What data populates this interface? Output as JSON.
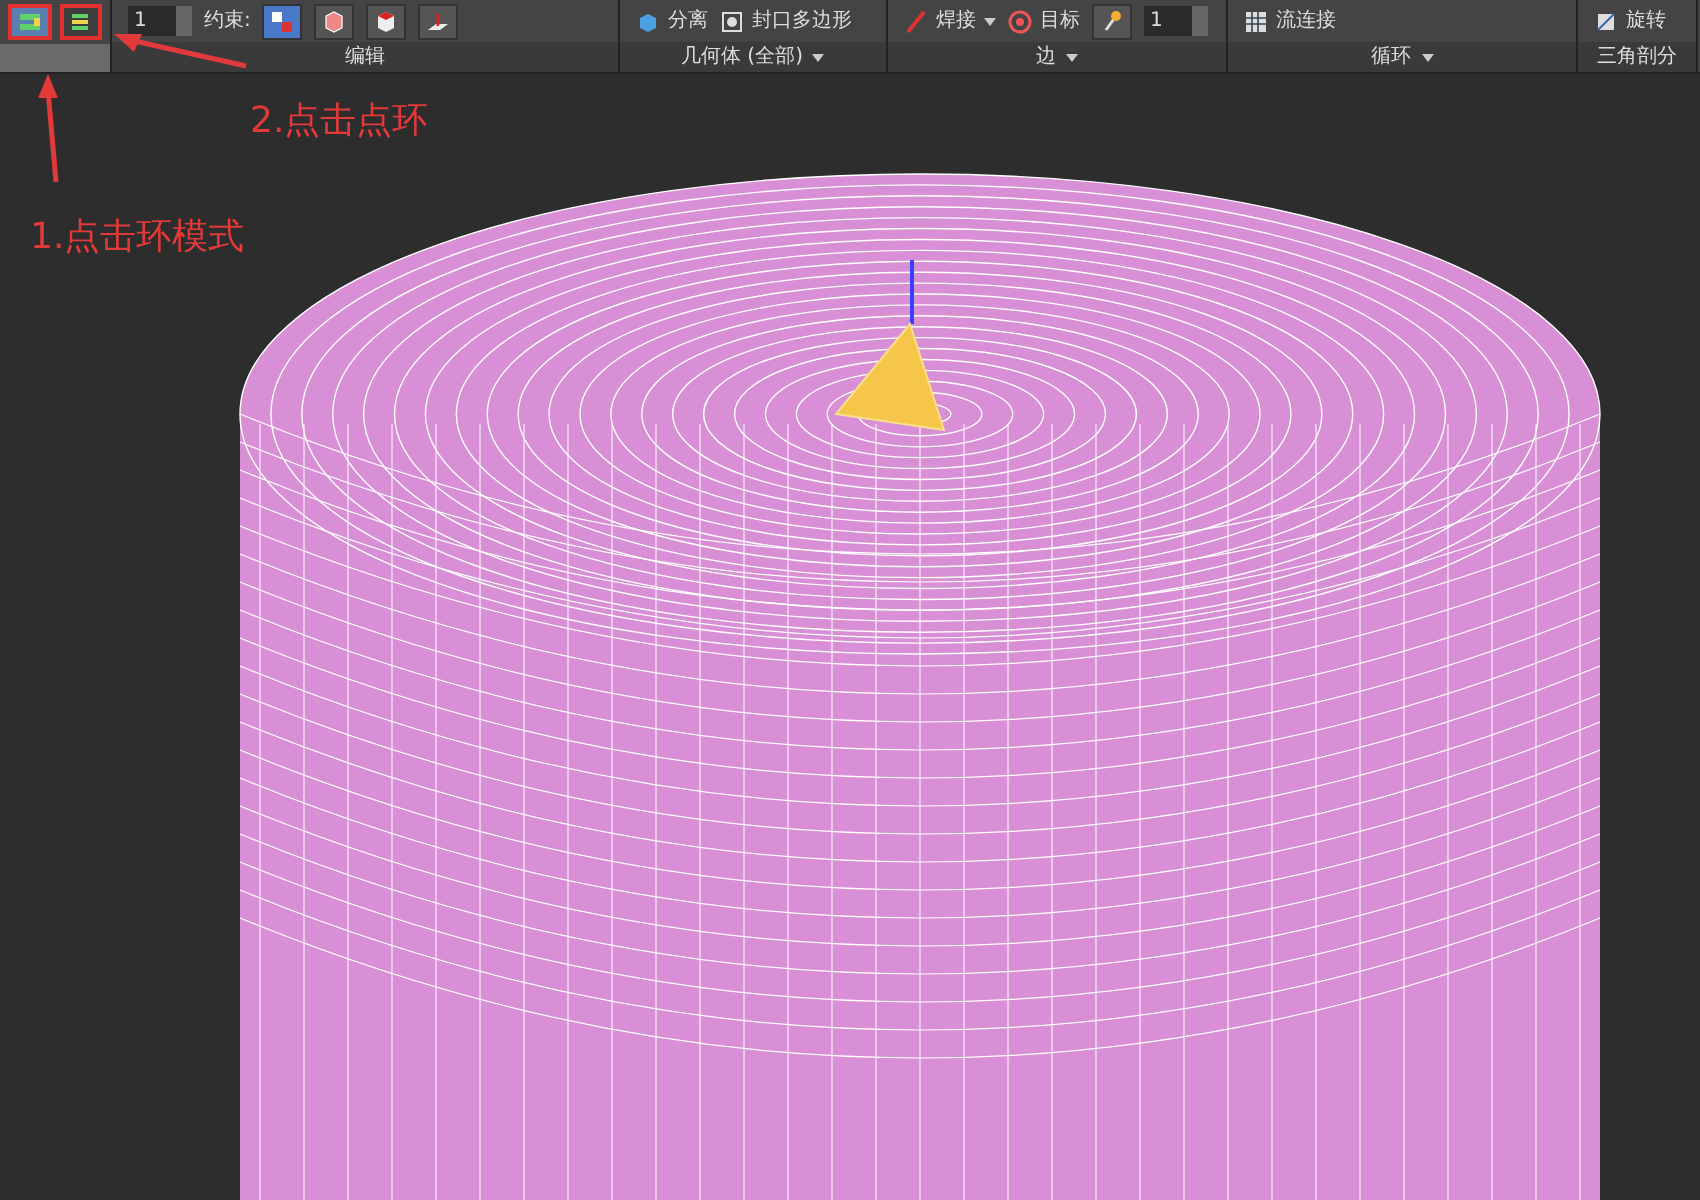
{
  "ribbon": {
    "mode_buttons": [
      {
        "kind": "ring",
        "selected": true
      },
      {
        "kind": "dot-ring",
        "selected": false
      }
    ],
    "groups": [
      {
        "label": "编辑",
        "dropdown": false,
        "controls": [
          {
            "kind": "spinner",
            "value": "1"
          },
          {
            "kind": "label",
            "text": "约束:"
          },
          {
            "kind": "toggle",
            "selected": true
          },
          {
            "kind": "toggle",
            "selected": false
          },
          {
            "kind": "toggle",
            "selected": false
          },
          {
            "kind": "toggle",
            "selected": false
          }
        ]
      },
      {
        "label": "几何体 (全部)",
        "dropdown": true,
        "controls": [
          {
            "kind": "button",
            "text": "分离"
          },
          {
            "kind": "button",
            "text": "封口多边形"
          }
        ]
      },
      {
        "label": "边",
        "dropdown": true,
        "controls": [
          {
            "kind": "menu-button",
            "text": "焊接"
          },
          {
            "kind": "button",
            "text": "目标"
          },
          {
            "kind": "toggle",
            "selected": false
          },
          {
            "kind": "spinner",
            "value": "1"
          }
        ]
      },
      {
        "label": "循环",
        "dropdown": true,
        "controls": [
          {
            "kind": "button",
            "text": "流连接"
          }
        ]
      },
      {
        "label": "三角剖分",
        "dropdown": false,
        "controls": [
          {
            "kind": "button",
            "text": "旋转"
          }
        ]
      }
    ]
  },
  "annotations": [
    {
      "text": "2.点击点环"
    },
    {
      "text": "1.点击环模式"
    }
  ]
}
